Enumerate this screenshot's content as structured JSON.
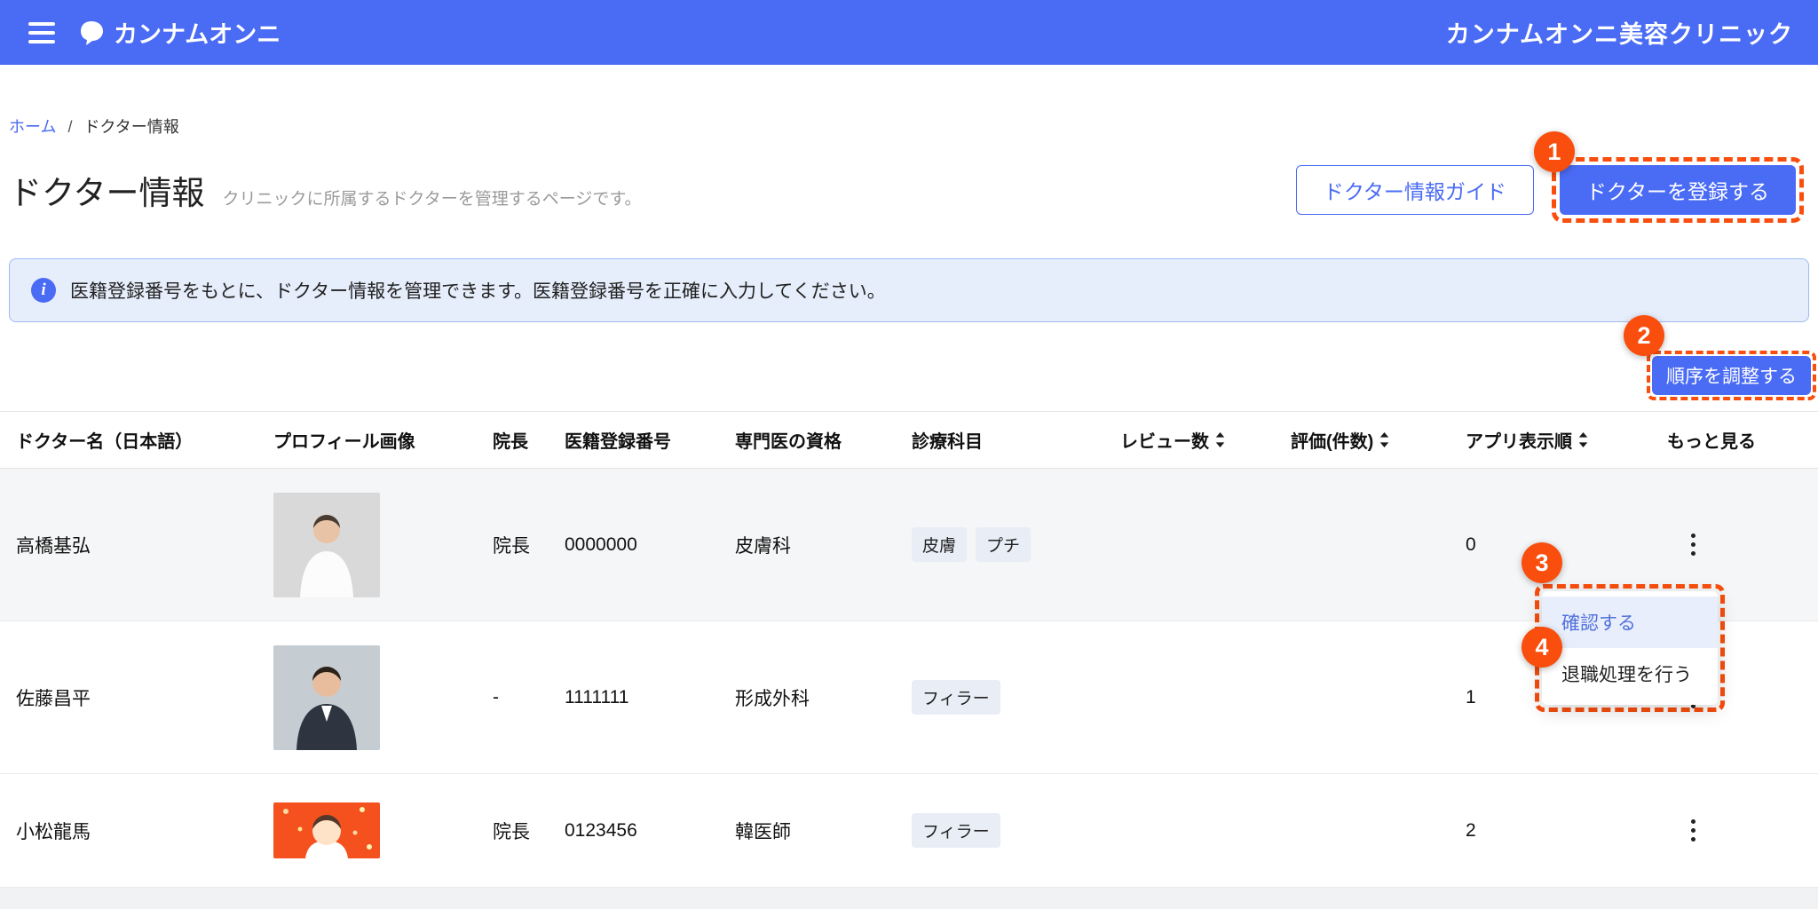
{
  "colors": {
    "primary": "#4A6BF4",
    "annotation": "#F94E0D",
    "banner_bg": "#E6EDFB",
    "banner_border": "#9FBBF3",
    "row_highlight": "#F5F6F7",
    "chip_bg": "#E9EDF5",
    "menu_active_bg": "#E8EEFB"
  },
  "icons": {
    "hamburger": "menu-icon",
    "logo": "gangnam-unni-logo-icon",
    "info_glyph": "i",
    "sort": "sort-arrows-icon",
    "kebab": "more-vertical-icon"
  },
  "topbar": {
    "logo_text": "カンナムオンニ",
    "clinic_name": "カンナムオンニ美容クリニック"
  },
  "breadcrumb": {
    "home": "ホーム",
    "separator": "/",
    "current": "ドクター情報"
  },
  "page_header": {
    "title": "ドクター情報",
    "subtitle": "クリニックに所属するドクターを管理するページです。",
    "guide_button": "ドクター情報ガイド",
    "register_button": "ドクターを登録する"
  },
  "banner": {
    "text": "医籍登録番号をもとに、ドクター情報を管理できます。医籍登録番号を正確に入力してください。"
  },
  "toolbar": {
    "order_button": "順序を調整する"
  },
  "table": {
    "headers": {
      "name": "ドクター名（日本語）",
      "image": "プロフィール画像",
      "director": "院長",
      "license": "医籍登録番号",
      "specialty": "専門医の資格",
      "departments": "診療科目",
      "reviews": "レビュー数",
      "rating": "評価(件数)",
      "app_order": "アプリ表示順",
      "more": "もっと見る"
    },
    "rows": [
      {
        "name": "高橋基弘",
        "director": "院長",
        "license": "0000000",
        "specialty": "皮膚科",
        "tags": [
          "皮膚",
          "プチ"
        ],
        "reviews": "",
        "rating": "",
        "app_order": "0"
      },
      {
        "name": "佐藤昌平",
        "director": "-",
        "license": "1111111",
        "specialty": "形成外科",
        "tags": [
          "フィラー"
        ],
        "reviews": "",
        "rating": "",
        "app_order": "1"
      },
      {
        "name": "小松龍馬",
        "director": "院長",
        "license": "0123456",
        "specialty": "韓医師",
        "tags": [
          "フィラー"
        ],
        "reviews": "",
        "rating": "",
        "app_order": "2"
      }
    ]
  },
  "context_menu": {
    "items": [
      {
        "label": "確認する"
      },
      {
        "label": "退職処理を行う"
      }
    ]
  },
  "annotations": {
    "badge1": "1",
    "badge2": "2",
    "badge3": "3",
    "badge4": "4"
  }
}
